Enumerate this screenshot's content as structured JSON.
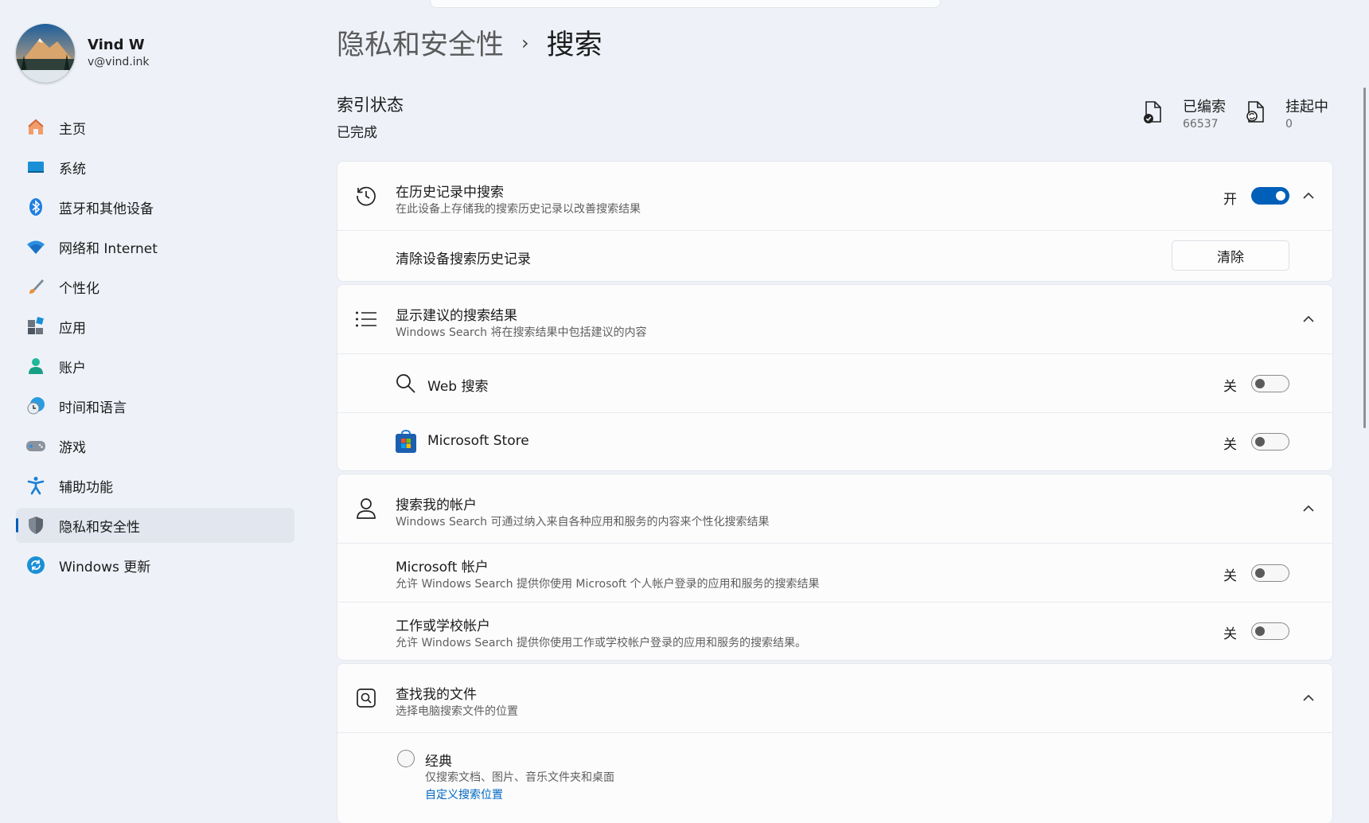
{
  "profile": {
    "name": "Vind W",
    "email": "v@vind.ink"
  },
  "sidebar": {
    "items": [
      {
        "label": "主页",
        "icon": "home-icon"
      },
      {
        "label": "系统",
        "icon": "system-icon"
      },
      {
        "label": "蓝牙和其他设备",
        "icon": "bluetooth-icon"
      },
      {
        "label": "网络和 Internet",
        "icon": "wifi-icon"
      },
      {
        "label": "个性化",
        "icon": "brush-icon"
      },
      {
        "label": "应用",
        "icon": "apps-icon"
      },
      {
        "label": "账户",
        "icon": "account-icon"
      },
      {
        "label": "时间和语言",
        "icon": "time-language-icon"
      },
      {
        "label": "游戏",
        "icon": "gamepad-icon"
      },
      {
        "label": "辅助功能",
        "icon": "accessibility-icon"
      },
      {
        "label": "隐私和安全性",
        "icon": "shield-icon",
        "selected": true
      },
      {
        "label": "Windows 更新",
        "icon": "update-icon"
      }
    ]
  },
  "header": {
    "parent": "隐私和安全性",
    "separator": "›",
    "current": "搜索"
  },
  "indexing": {
    "title": "索引状态",
    "status": "已完成",
    "indexed_label": "已编索",
    "indexed_value": "66537",
    "pending_label": "挂起中",
    "pending_value": "0"
  },
  "history": {
    "title": "在历史记录中搜索",
    "desc": "在此设备上存储我的搜索历史记录以改善搜索结果",
    "toggle_label": "开",
    "toggle_on": true,
    "clear_title": "清除设备搜索历史记录",
    "clear_button": "清除"
  },
  "suggested": {
    "title": "显示建议的搜索结果",
    "desc": "Windows Search 将在搜索结果中包括建议的内容",
    "web_label": "Web 搜索",
    "web_toggle_label": "关",
    "store_label": "Microsoft Store",
    "store_toggle_label": "关"
  },
  "accounts": {
    "title": "搜索我的帐户",
    "desc": "Windows Search 可通过纳入来自各种应用和服务的内容来个性化搜索结果",
    "ms_title": "Microsoft 帐户",
    "ms_desc": "允许 Windows Search 提供你使用 Microsoft 个人帐户登录的应用和服务的搜索结果",
    "ms_toggle_label": "关",
    "work_title": "工作或学校帐户",
    "work_desc": "允许 Windows Search 提供你使用工作或学校帐户登录的应用和服务的搜索结果。",
    "work_toggle_label": "关"
  },
  "files": {
    "title": "查找我的文件",
    "desc": "选择电脑搜索文件的位置",
    "classic_title": "经典",
    "classic_desc": "仅搜索文档、图片、音乐文件夹和桌面",
    "classic_link": "自定义搜索位置"
  },
  "colors": {
    "accent": "#005fb8",
    "link": "#0067c0",
    "background": "#eef2f8"
  }
}
